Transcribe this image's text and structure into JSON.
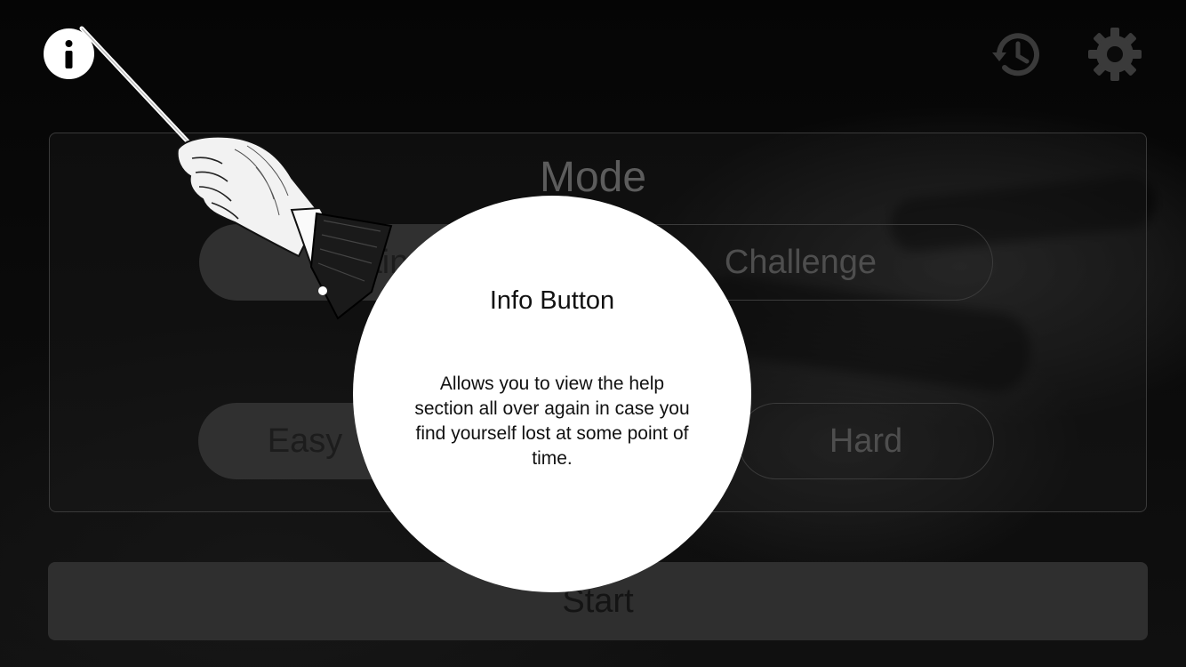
{
  "top_bar": {
    "info_icon": "info-icon",
    "history_icon": "history-icon",
    "settings_icon": "gear-icon"
  },
  "mode_panel": {
    "title": "Mode",
    "mode_options": [
      {
        "label": "Training",
        "visible_text": "ain",
        "selected": true
      },
      {
        "label": "Challenge",
        "selected": false
      }
    ],
    "difficulty_options": [
      {
        "label": "Easy",
        "visible_text": "Easy",
        "selected": true
      },
      {
        "label": "Hard",
        "selected": false
      }
    ]
  },
  "start_button": {
    "label": "Start"
  },
  "tutorial": {
    "title": "Info Button",
    "body": "Allows you to view the help section all over again in case you find yourself lost at some point of time."
  },
  "colors": {
    "background": "#070707",
    "spotlight": "#ffffff",
    "panel_border": "#3a3a3a"
  }
}
